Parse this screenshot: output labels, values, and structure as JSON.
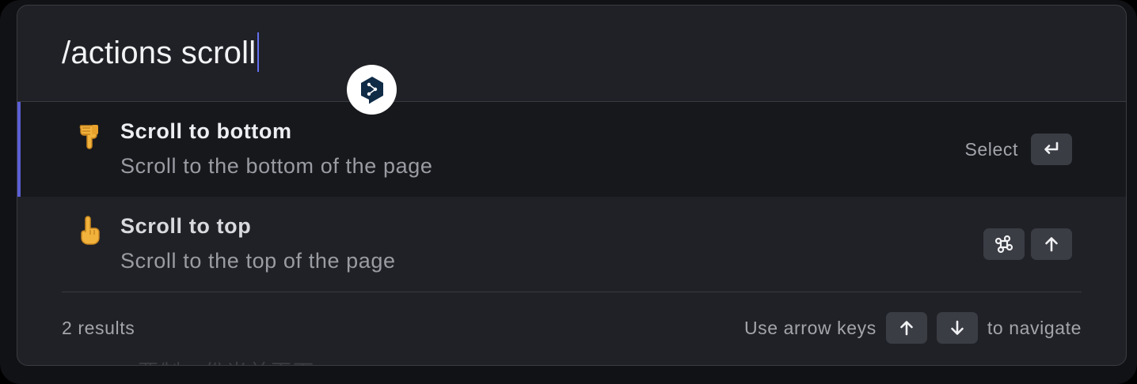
{
  "search": {
    "query": "/actions scroll"
  },
  "results": [
    {
      "emoji": "pointing-down-hand-icon",
      "title": "Scroll to bottom",
      "subtitle": "Scroll to the bottom of the page",
      "selected": true,
      "shortcut_label": "Select",
      "shortcut_keys": [
        "return-key-icon"
      ]
    },
    {
      "emoji": "pointing-up-hand-icon",
      "title": "Scroll to top",
      "subtitle": "Scroll to the top of the page",
      "selected": false,
      "shortcut_keys": [
        "command-key-icon",
        "arrow-up-key-icon"
      ]
    }
  ],
  "footer": {
    "count_text": "2 results",
    "hint_prefix": "Use arrow keys",
    "hint_suffix": "to navigate"
  },
  "colors": {
    "accent": "#5b5fd6",
    "caret": "#6470f0",
    "panel_bg": "#202126",
    "selected_bg": "#17181c",
    "kbd_bg": "#3b3d45"
  },
  "background_ghost_text": "要制一份当前页面"
}
